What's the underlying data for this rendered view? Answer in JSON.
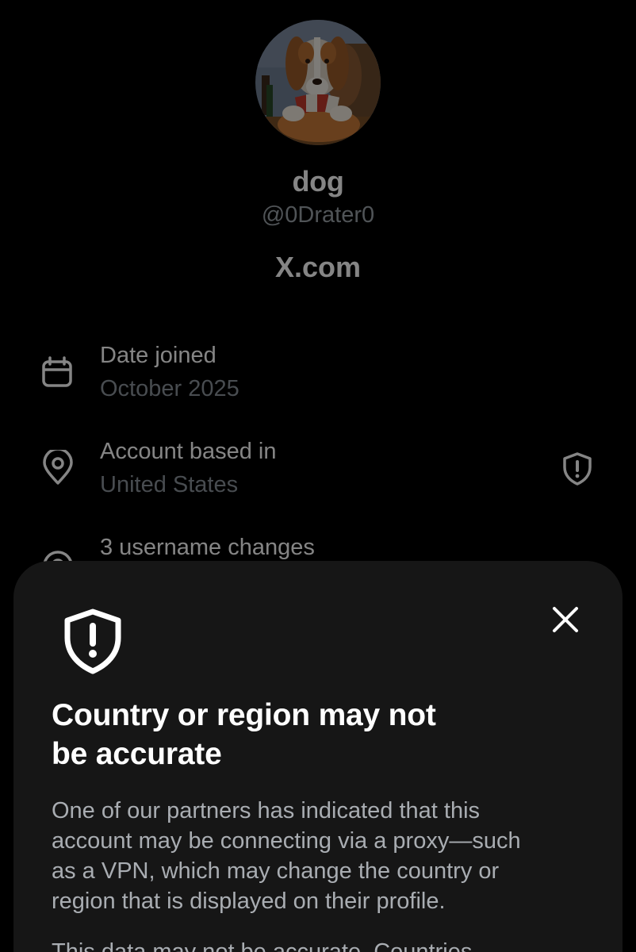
{
  "profile": {
    "display_name": "dog",
    "handle": "@0Drater0",
    "website": "X.com",
    "avatar_icon": "dog-poker-painting-avatar"
  },
  "about": {
    "date_joined": {
      "label": "Date joined",
      "value": "October 2025",
      "icon": "calendar-icon"
    },
    "account_based_in": {
      "label": "Account based in",
      "value": "United States",
      "icon": "location-pin-icon",
      "badge_icon": "shield-alert-icon"
    },
    "username_changes": {
      "label": "3 username changes",
      "icon": "history-icon"
    }
  },
  "sheet": {
    "icon": "shield-exclamation-icon",
    "close_icon": "close-icon",
    "title_line1": "Country or region may not",
    "title_line2": "be accurate",
    "body_line1": "One of our partners has indicated that this",
    "body_line2": "account may be connecting via a proxy—such",
    "body_line3": "as a VPN, which may change the country or",
    "body_line4": "region that is displayed on their profile.",
    "body2_line1": "This data may not be accurate. Countries"
  },
  "colors": {
    "background": "#000000",
    "sheet_background": "#161616",
    "primary_text": "#ffffff",
    "secondary_text": "#a9adb2"
  }
}
